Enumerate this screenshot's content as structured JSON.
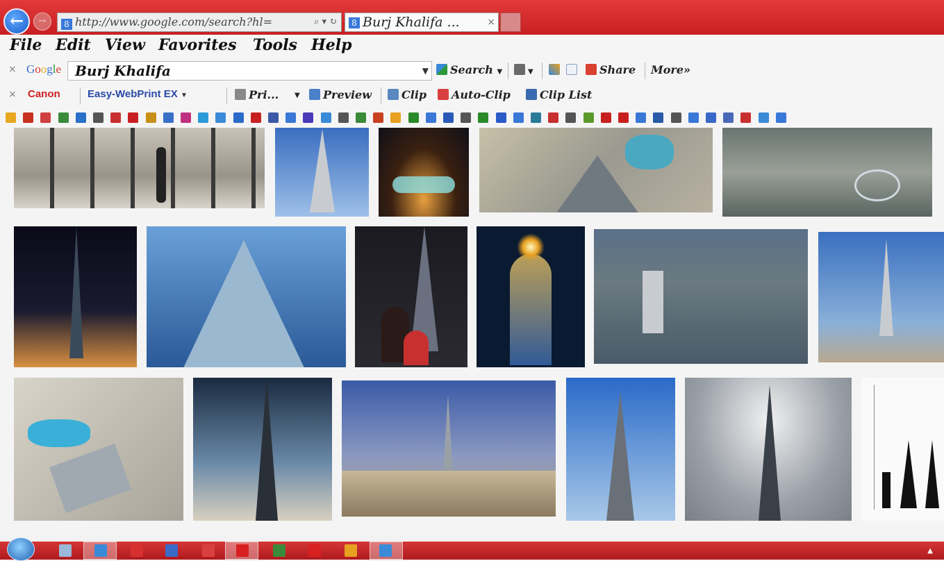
{
  "browser": {
    "address_url": "http://www.google.com/search?hl=",
    "address_tools": "⌕ ▾ ↻",
    "tab_title": "Burj Khalifa ...",
    "tab_close": "×"
  },
  "menu": {
    "items": [
      "File",
      "Edit",
      "View",
      "Favorites",
      "Tools",
      "Help"
    ]
  },
  "google_toolbar": {
    "close": "×",
    "logo_letters": [
      "G",
      "o",
      "o",
      "g",
      "l",
      "e"
    ],
    "logo_colors": [
      "#3a6fd8",
      "#d8342c",
      "#e8b018",
      "#3a6fd8",
      "#2a9a3a",
      "#d8342c"
    ],
    "search_value": "Burj Khalifa",
    "search_label": "Search",
    "share_label": "Share",
    "more_label": "More»"
  },
  "canon_toolbar": {
    "close": "×",
    "brand": "Canon",
    "easy_webprint": "Easy-WebPrint EX",
    "print": "Pri...",
    "preview": "Preview",
    "clip": "Clip",
    "auto_clip": "Auto-Clip",
    "clip_list": "Clip List"
  },
  "favorites_bar": {
    "icon_colors": [
      "#e8a820",
      "#c83020",
      "#d04040",
      "#3a8a3a",
      "#2a70c8",
      "#555",
      "#c83030",
      "#c82020",
      "#c89018",
      "#3a70c8",
      "#c03080",
      "#2a9ad8",
      "#3a8ad8",
      "#2a6ac8",
      "#c82020",
      "#3a5aa8",
      "#3a78d8",
      "#4a3ab8",
      "#3a8ad8",
      "#555",
      "#3a8a3a",
      "#c84020",
      "#e8a020",
      "#2a8a2a",
      "#3a78d8",
      "#2a5ab8",
      "#555",
      "#2a8a2a",
      "#2a5ac8",
      "#3a78d8",
      "#2a7a9a",
      "#c83030",
      "#555",
      "#5a9a2a",
      "#c82020",
      "#c82020",
      "#3a78d8",
      "#2a5aa8",
      "#555",
      "#3a78d8",
      "#3a68c8",
      "#4a68b8",
      "#c83030",
      "#3a8ad8",
      "#3a78d8"
    ]
  },
  "taskbar": {
    "tray_arrow": "▲",
    "app_colors": [
      "#9ab8d8",
      "#3a8ad8",
      "#d83030",
      "#3a6ac8",
      "#d84040",
      "#d82020",
      "#3a8a3a",
      "#d82020",
      "#e8a020",
      "#3a8ad8"
    ]
  }
}
